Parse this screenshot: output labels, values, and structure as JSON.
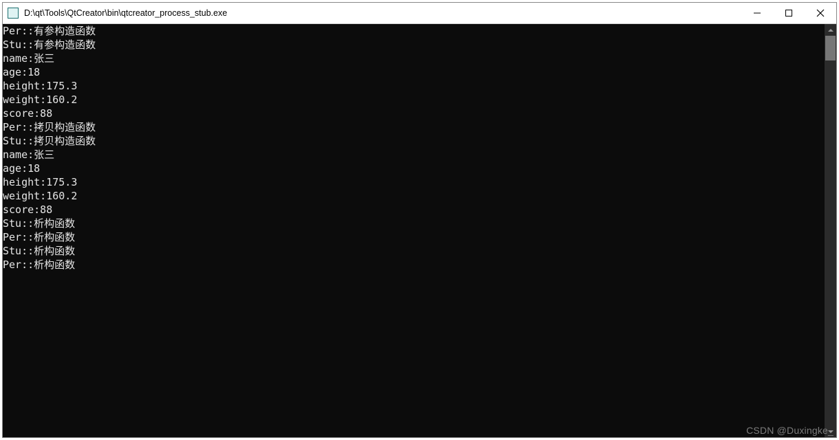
{
  "window": {
    "title": "D:\\qt\\Tools\\QtCreator\\bin\\qtcreator_process_stub.exe"
  },
  "console": {
    "lines": [
      "Per::有参构造函数",
      "Stu::有参构造函数",
      "name:张三",
      "age:18",
      "height:175.3",
      "weight:160.2",
      "score:88",
      "Per::拷贝构造函数",
      "Stu::拷贝构造函数",
      "name:张三",
      "age:18",
      "height:175.3",
      "weight:160.2",
      "score:88",
      "Stu::析构函数",
      "Per::析构函数",
      "Stu::析构函数",
      "Per::析构函数"
    ]
  },
  "watermark": "CSDN @Duxingke_"
}
